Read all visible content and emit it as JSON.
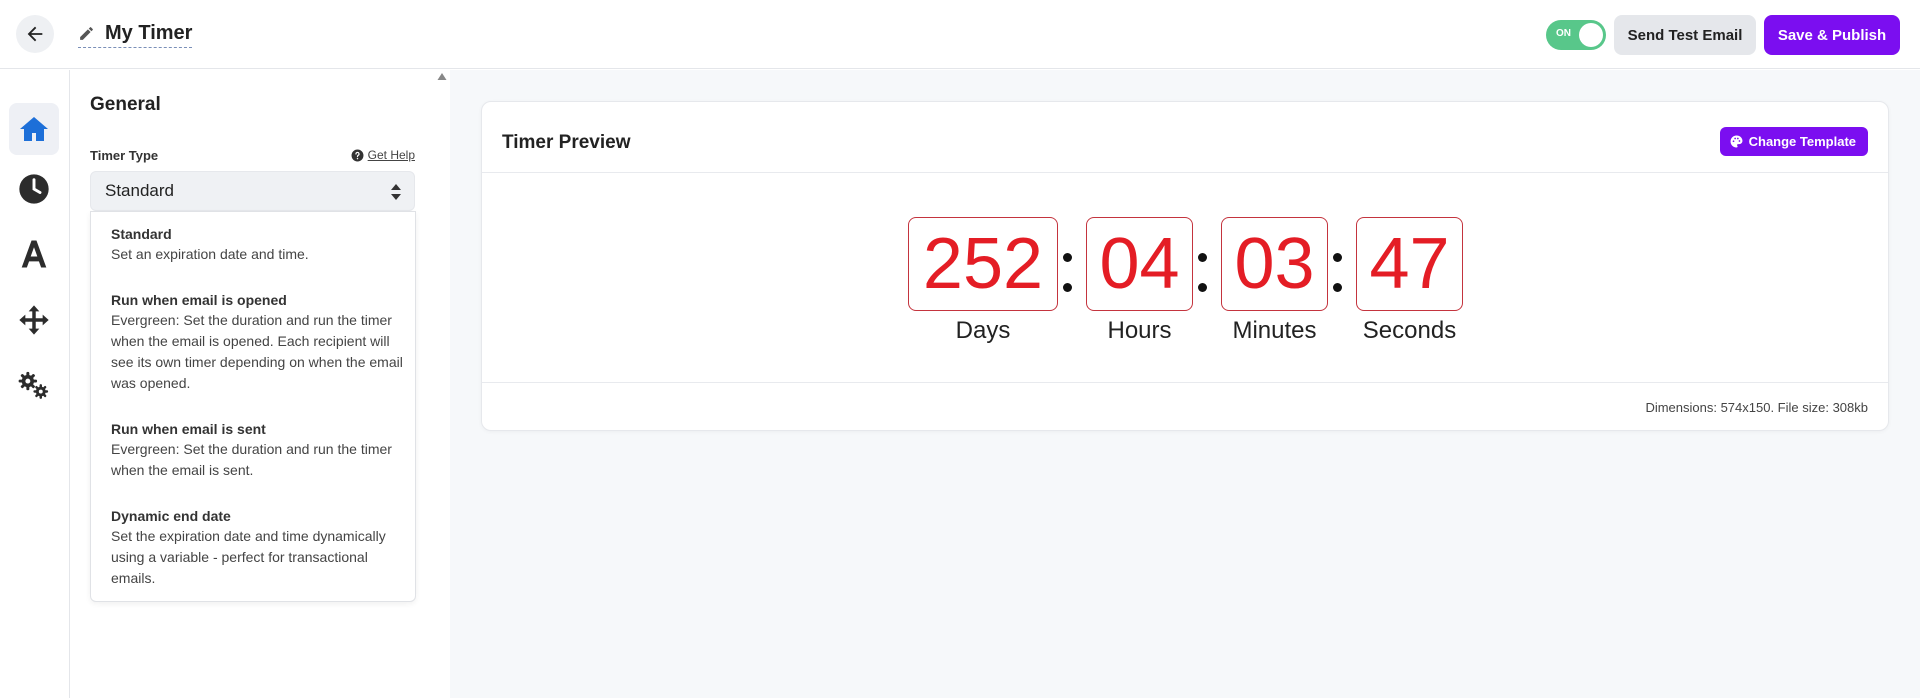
{
  "header": {
    "title": "My Timer",
    "toggle_label": "ON",
    "send_test_label": "Send Test Email",
    "publish_label": "Save & Publish"
  },
  "nav": {
    "items": [
      {
        "icon": "home-icon",
        "active": true
      },
      {
        "icon": "clock-icon",
        "active": false
      },
      {
        "icon": "font-icon",
        "active": false
      },
      {
        "icon": "move-icon",
        "active": false
      },
      {
        "icon": "gears-icon",
        "active": false
      }
    ]
  },
  "panel": {
    "title": "General",
    "timer_type_label": "Timer Type",
    "help_label": "Get Help",
    "selected": "Standard",
    "options": [
      {
        "title": "Standard",
        "desc": "Set an expiration date and time."
      },
      {
        "title": "Run when email is opened",
        "desc": "Evergreen: Set the duration and run the timer when the email is opened. Each recipient will see its own timer depending on when the email was opened."
      },
      {
        "title": "Run when email is sent",
        "desc": "Evergreen: Set the duration and run the timer when the email is sent."
      },
      {
        "title": "Dynamic end date",
        "desc": "Set the expiration date and time dynamically using a variable - perfect for transactional emails."
      }
    ]
  },
  "preview": {
    "title": "Timer Preview",
    "change_template_label": "Change Template",
    "days": "252",
    "hours": "04",
    "minutes": "03",
    "seconds": "47",
    "days_label": "Days",
    "hours_label": "Hours",
    "minutes_label": "Minutes",
    "seconds_label": "Seconds",
    "dimensions": "Dimensions: 574x150. File size: 308kb"
  },
  "colors": {
    "accent": "#7b0ef0",
    "toggle_on": "#58c78a",
    "digit_red": "#e41d25",
    "nav_active": "#1d6fd8"
  }
}
